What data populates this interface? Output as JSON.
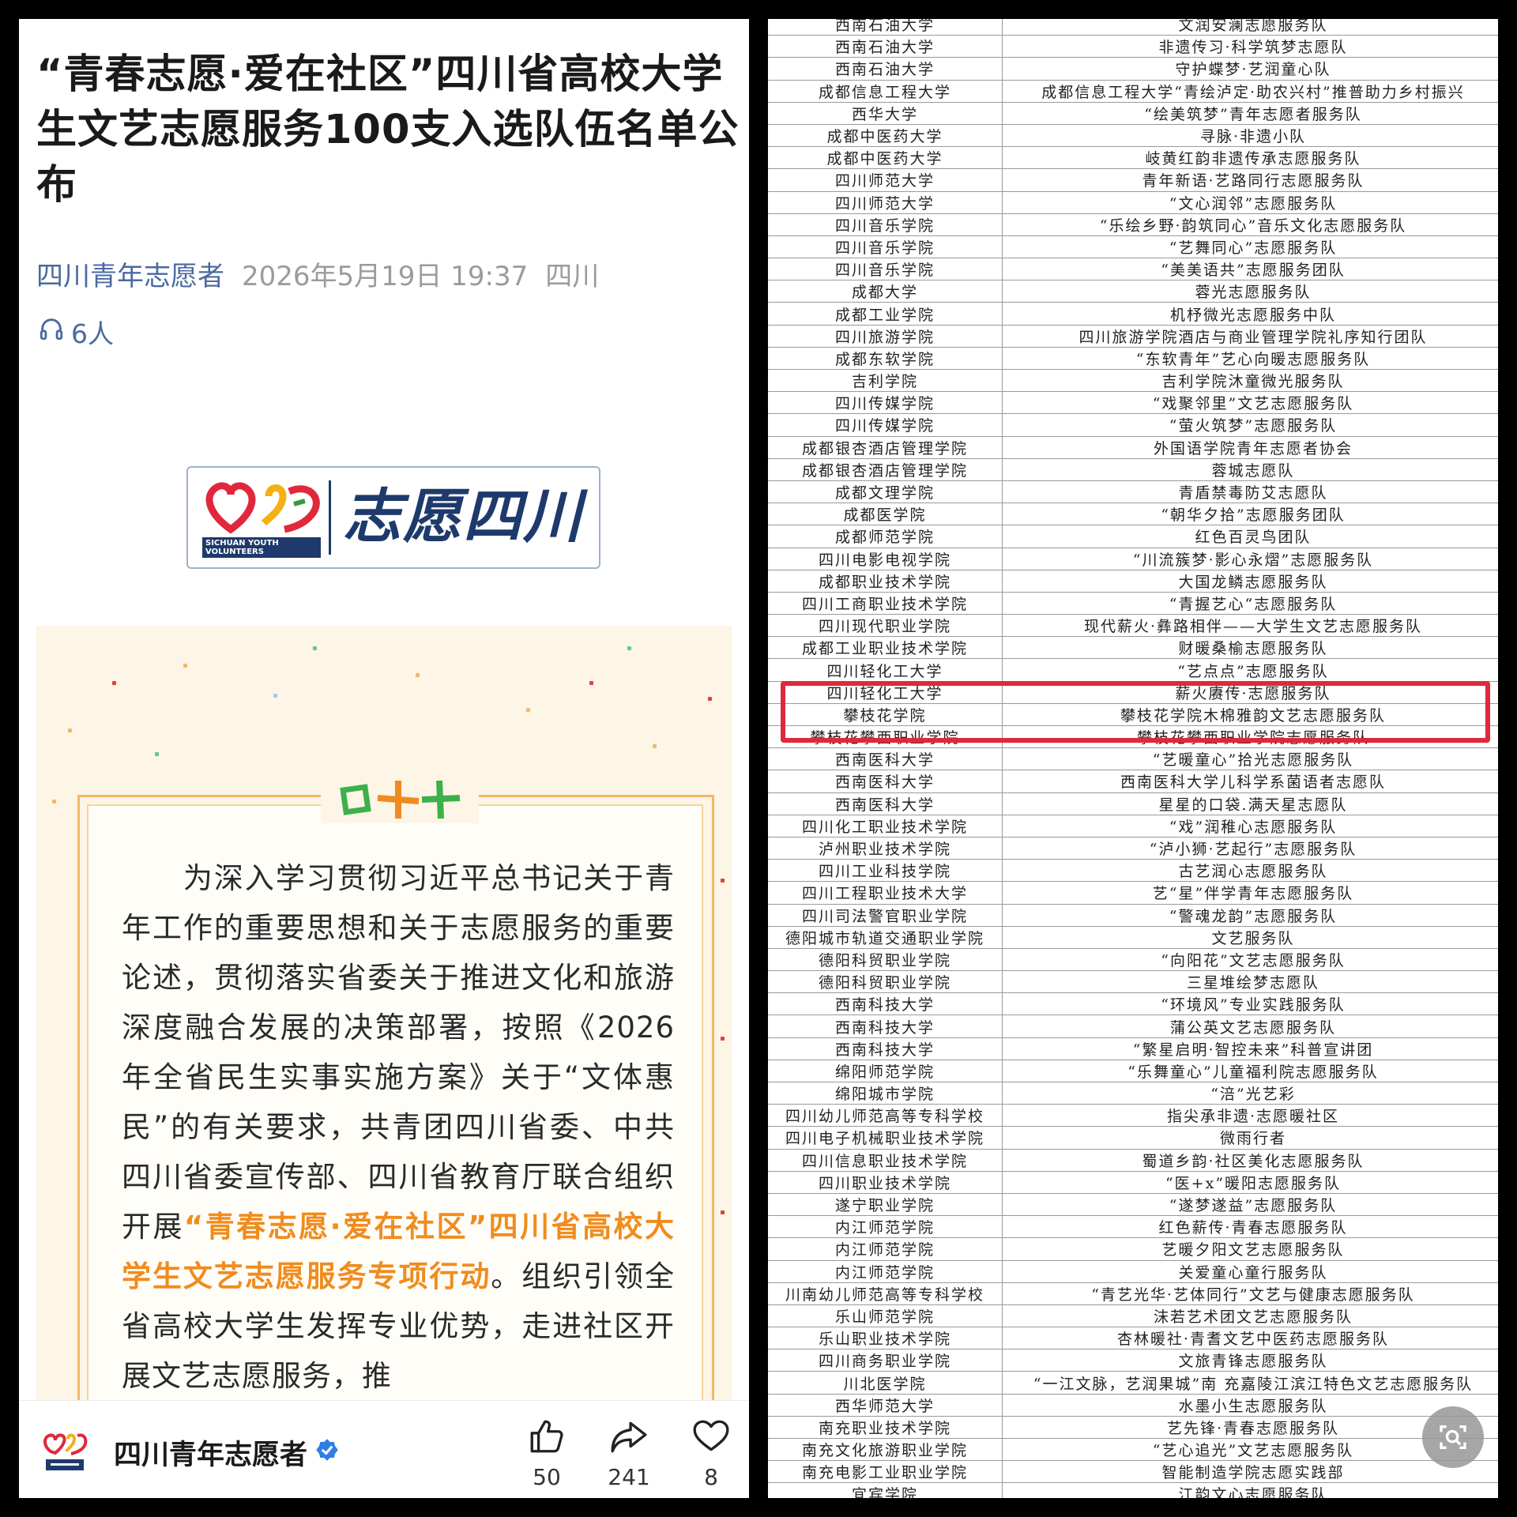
{
  "article": {
    "title": "“青春志愿·爱在社区”四川省高校大学生文艺志愿服务100支入选队伍名单公布",
    "author": "四川青年志愿者",
    "date": "2026年5月19日 19:37",
    "location": "四川",
    "listen_count": "6人",
    "logo_en": "SICHUAN YOUTH VOLUNTEERS",
    "logo_cn": "志愿四川",
    "para_before": "为深入学习贯彻习近平总书记关于青年工作的重要思想和关于志愿服务的重要论述，贯彻落实省委关于推进文化和旅游深度融合发展的决策部署，按照《2026年全省民生实事实施方案》关于“文体惠民”的有关要求，共青团四川省委、中共四川省委宣传部、四川省教育厅联合组织开展",
    "para_highlight": "“青春志愿·爱在社区”四川省高校大学生文艺志愿服务专项行动",
    "para_after": "。组织引领全省高校大学生发挥专业优势，走进社区开展文艺志愿服务，推"
  },
  "bottombar": {
    "account_name": "四川青年志愿者",
    "like_count": "50",
    "share_count": "241",
    "fav_count": "8"
  },
  "icons": {
    "listen": "headphones-icon",
    "verified": "verified-badge-icon",
    "like": "thumbs-up-icon",
    "share": "share-icon",
    "favorite": "heart-icon",
    "lens": "image-search-icon"
  },
  "colors": {
    "highlight_orange": "#f08c1e",
    "author_blue": "#4a6aa0",
    "logo_navy": "#1e3a6c",
    "red_box": "#e0283c",
    "verified_blue": "#2f7ee6"
  },
  "table": {
    "rows": [
      [
        "西南石油大学",
        "文润安澜志愿服务队"
      ],
      [
        "西南石油大学",
        "非遗传习·科学筑梦志愿队"
      ],
      [
        "西南石油大学",
        "守护蝶梦·艺润童心队"
      ],
      [
        "成都信息工程大学",
        "成都信息工程大学“青绘泸定·助农兴村”推普助力乡村振兴"
      ],
      [
        "西华大学",
        "“绘美筑梦”青年志愿者服务队"
      ],
      [
        "成都中医药大学",
        "寻脉·非遗小队"
      ],
      [
        "成都中医药大学",
        "岐黄红韵非遗传承志愿服务队"
      ],
      [
        "四川师范大学",
        "青年新语·艺路同行志愿服务队"
      ],
      [
        "四川师范大学",
        "“文心润邻”志愿服务队"
      ],
      [
        "四川音乐学院",
        "“乐绘乡野·韵筑同心”音乐文化志愿服务队"
      ],
      [
        "四川音乐学院",
        "“艺舞同心”志愿服务队"
      ],
      [
        "四川音乐学院",
        "“美美语共”志愿服务团队"
      ],
      [
        "成都大学",
        "蓉光志愿服务队"
      ],
      [
        "成都工业学院",
        "机杼微光志愿服务中队"
      ],
      [
        "四川旅游学院",
        "四川旅游学院酒店与商业管理学院礼序知行团队"
      ],
      [
        "成都东软学院",
        "“东软青年”艺心向暖志愿服务队"
      ],
      [
        "吉利学院",
        "吉利学院沐童微光服务队"
      ],
      [
        "四川传媒学院",
        "“戏聚邻里”文艺志愿服务队"
      ],
      [
        "四川传媒学院",
        "“萤火筑梦”志愿服务队"
      ],
      [
        "成都银杏酒店管理学院",
        "外国语学院青年志愿者协会"
      ],
      [
        "成都银杏酒店管理学院",
        "蓉城志愿队"
      ],
      [
        "成都文理学院",
        "青盾禁毒防艾志愿队"
      ],
      [
        "成都医学院",
        "“朝华夕拾”志愿服务团队"
      ],
      [
        "成都师范学院",
        "红色百灵鸟团队"
      ],
      [
        "四川电影电视学院",
        "“川流簇梦·影心永熠”志愿服务队"
      ],
      [
        "成都职业技术学院",
        "大国龙鳞志愿服务队"
      ],
      [
        "四川工商职业技术学院",
        "“青握艺心“志愿服务队"
      ],
      [
        "四川现代职业学院",
        "现代薪火·彝路相伴——大学生文艺志愿服务队"
      ],
      [
        "成都工业职业技术学院",
        "财暖桑榆志愿服务队"
      ],
      [
        "四川轻化工大学",
        "“艺点点”志愿服务队"
      ],
      [
        "四川轻化工大学",
        "薪火赓传·志愿服务队"
      ],
      [
        "攀枝花学院",
        "攀枝花学院木棉雅韵文艺志愿服务队"
      ],
      [
        "攀枝花攀西职业学院",
        "攀枝花攀西职业学院志愿服务队"
      ],
      [
        "西南医科大学",
        "“艺暖童心”拾光志愿服务队"
      ],
      [
        "西南医科大学",
        "西南医科大学儿科学系菌语者志愿队"
      ],
      [
        "西南医科大学",
        "星星的口袋.满天星志愿队"
      ],
      [
        "四川化工职业技术学院",
        "“戏”润稚心志愿服务队"
      ],
      [
        "泸州职业技术学院",
        "“泸小狮·艺起行”志愿服务队"
      ],
      [
        "四川工业科技学院",
        "古艺润心志愿服务队"
      ],
      [
        "四川工程职业技术大学",
        "艺“星”伴学青年志愿服务队"
      ],
      [
        "四川司法警官职业学院",
        "“警魂龙韵”志愿服务队"
      ],
      [
        "德阳城市轨道交通职业学院",
        "文艺服务队"
      ],
      [
        "德阳科贸职业学院",
        "“向阳花”文艺志愿服务队"
      ],
      [
        "德阳科贸职业学院",
        "三星堆绘梦志愿队"
      ],
      [
        "西南科技大学",
        "“环境风”专业实践服务队"
      ],
      [
        "西南科技大学",
        "蒲公英文艺志愿服务队"
      ],
      [
        "西南科技大学",
        "“繁星启明·智控未来”科普宣讲团"
      ],
      [
        "绵阳师范学院",
        "“乐舞童心”儿童福利院志愿服务队"
      ],
      [
        "绵阳城市学院",
        "“涪”光艺彩"
      ],
      [
        "四川幼儿师范高等专科学校",
        "指尖承非遗·志愿暖社区"
      ],
      [
        "四川电子机械职业技术学院",
        "微雨行者"
      ],
      [
        "四川信息职业技术学院",
        "蜀道乡韵·社区美化志愿服务队"
      ],
      [
        "四川职业技术学院",
        "“医+x”暖阳志愿服务队"
      ],
      [
        "遂宁职业学院",
        "“遂梦遂益”志愿服务队"
      ],
      [
        "内江师范学院",
        "红色薪传·青春志愿服务队"
      ],
      [
        "内江师范学院",
        "艺暖夕阳文艺志愿服务队"
      ],
      [
        "内江师范学院",
        "关爱童心童行服务队"
      ],
      [
        "川南幼儿师范高等专科学校",
        "“青艺光华·艺体同行”文艺与健康志愿服务队"
      ],
      [
        "乐山师范学院",
        "沫若艺术团文艺志愿服务队"
      ],
      [
        "乐山职业技术学院",
        "杏林暖社·青耆文艺中医药志愿服务队"
      ],
      [
        "四川商务职业学院",
        "文旅青锋志愿服务队"
      ],
      [
        "川北医学院",
        "“一江文脉，艺润果城”南 充嘉陵江滨江特色文艺志愿服务队"
      ],
      [
        "西华师范大学",
        "水墨小生志愿服务队"
      ],
      [
        "南充职业技术学院",
        "艺先锋·青春志愿服务队"
      ],
      [
        "南充文化旅游职业学院",
        "“艺心追光”文艺志愿服务队"
      ],
      [
        "南充电影工业职业学院",
        "智能制造学院志愿实践部"
      ],
      [
        "宜宾学院",
        "江韵文心志愿服务队"
      ]
    ]
  }
}
